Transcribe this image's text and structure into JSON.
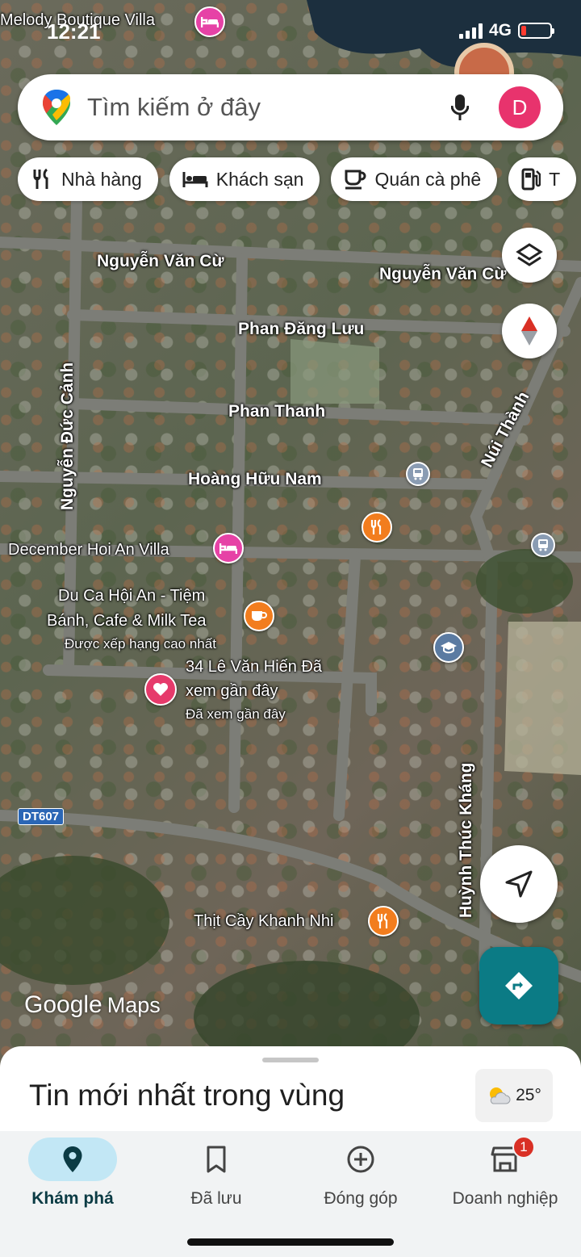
{
  "status": {
    "time": "12:21",
    "network": "4G"
  },
  "search": {
    "placeholder": "Tìm kiếm ở đây",
    "avatar_letter": "D"
  },
  "chips": [
    {
      "label": "Nhà hàng",
      "icon": "restaurant-icon"
    },
    {
      "label": "Khách sạn",
      "icon": "hotel-icon"
    },
    {
      "label": "Quán cà phê",
      "icon": "coffee-icon"
    },
    {
      "label": "T",
      "icon": "gas-station-icon"
    }
  ],
  "map": {
    "streets": [
      "Nguyễn Văn Cừ",
      "Nguyễn Văn Cừ",
      "Phan Đăng Lưu",
      "Phan Thanh",
      "Hoàng Hữu Nam",
      "Nguyễn Đức Cảnh",
      "Núi Thành",
      "Huỳnh Thúc Kháng"
    ],
    "road_shield": "DT607",
    "places": {
      "melody": "Melody Boutique Villa",
      "december": "December Hoi An Villa",
      "duca_line1": "Du Ca Hội An - Tiệm",
      "duca_line2": "Bánh, Cafe & Milk Tea",
      "duca_sub": "Được xếp hạng cao nhất",
      "saved_line1": "34 Lê Văn Hiến Đã",
      "saved_line2": "xem gần đây",
      "saved_sub": "Đã xem gần đây",
      "thitcay": "Thịt Cầy Khanh Nhi"
    },
    "watermark_google": "Google",
    "watermark_maps": "Maps"
  },
  "sheet": {
    "title": "Tin mới nhất trong vùng",
    "temperature": "25°"
  },
  "nav": [
    {
      "label": "Khám phá",
      "icon": "explore-pin-icon",
      "active": true
    },
    {
      "label": "Đã lưu",
      "icon": "bookmark-icon"
    },
    {
      "label": "Đóng góp",
      "icon": "add-circle-icon"
    },
    {
      "label": "Doanh nghiệp",
      "icon": "business-store-icon",
      "badge": "1"
    }
  ],
  "colors": {
    "accent": "#0b7b85",
    "avatar": "#e8336d",
    "active_nav_bg": "#c2e7f5",
    "badge": "#d93025"
  }
}
